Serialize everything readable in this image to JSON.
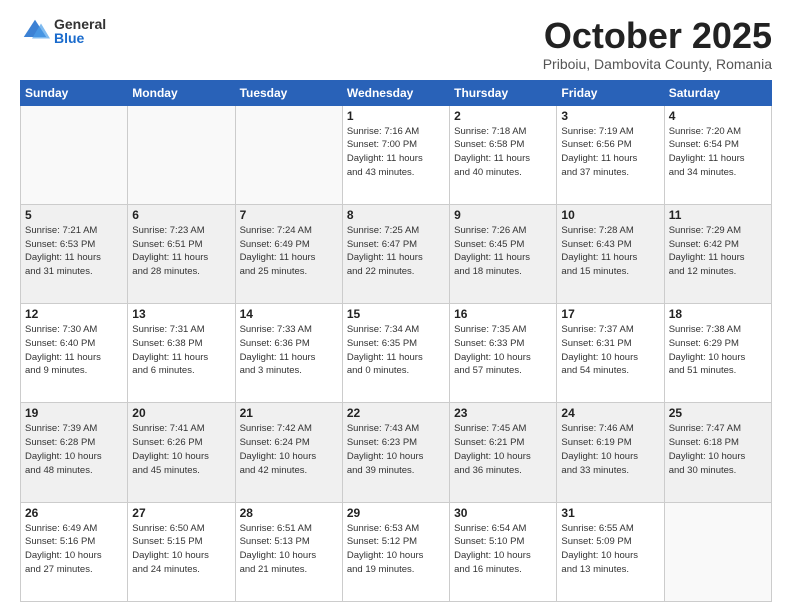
{
  "logo": {
    "general": "General",
    "blue": "Blue"
  },
  "header": {
    "month": "October 2025",
    "location": "Priboiu, Dambovita County, Romania"
  },
  "days_of_week": [
    "Sunday",
    "Monday",
    "Tuesday",
    "Wednesday",
    "Thursday",
    "Friday",
    "Saturday"
  ],
  "weeks": [
    [
      {
        "day": "",
        "info": ""
      },
      {
        "day": "",
        "info": ""
      },
      {
        "day": "",
        "info": ""
      },
      {
        "day": "1",
        "info": "Sunrise: 7:16 AM\nSunset: 7:00 PM\nDaylight: 11 hours\nand 43 minutes."
      },
      {
        "day": "2",
        "info": "Sunrise: 7:18 AM\nSunset: 6:58 PM\nDaylight: 11 hours\nand 40 minutes."
      },
      {
        "day": "3",
        "info": "Sunrise: 7:19 AM\nSunset: 6:56 PM\nDaylight: 11 hours\nand 37 minutes."
      },
      {
        "day": "4",
        "info": "Sunrise: 7:20 AM\nSunset: 6:54 PM\nDaylight: 11 hours\nand 34 minutes."
      }
    ],
    [
      {
        "day": "5",
        "info": "Sunrise: 7:21 AM\nSunset: 6:53 PM\nDaylight: 11 hours\nand 31 minutes."
      },
      {
        "day": "6",
        "info": "Sunrise: 7:23 AM\nSunset: 6:51 PM\nDaylight: 11 hours\nand 28 minutes."
      },
      {
        "day": "7",
        "info": "Sunrise: 7:24 AM\nSunset: 6:49 PM\nDaylight: 11 hours\nand 25 minutes."
      },
      {
        "day": "8",
        "info": "Sunrise: 7:25 AM\nSunset: 6:47 PM\nDaylight: 11 hours\nand 22 minutes."
      },
      {
        "day": "9",
        "info": "Sunrise: 7:26 AM\nSunset: 6:45 PM\nDaylight: 11 hours\nand 18 minutes."
      },
      {
        "day": "10",
        "info": "Sunrise: 7:28 AM\nSunset: 6:43 PM\nDaylight: 11 hours\nand 15 minutes."
      },
      {
        "day": "11",
        "info": "Sunrise: 7:29 AM\nSunset: 6:42 PM\nDaylight: 11 hours\nand 12 minutes."
      }
    ],
    [
      {
        "day": "12",
        "info": "Sunrise: 7:30 AM\nSunset: 6:40 PM\nDaylight: 11 hours\nand 9 minutes."
      },
      {
        "day": "13",
        "info": "Sunrise: 7:31 AM\nSunset: 6:38 PM\nDaylight: 11 hours\nand 6 minutes."
      },
      {
        "day": "14",
        "info": "Sunrise: 7:33 AM\nSunset: 6:36 PM\nDaylight: 11 hours\nand 3 minutes."
      },
      {
        "day": "15",
        "info": "Sunrise: 7:34 AM\nSunset: 6:35 PM\nDaylight: 11 hours\nand 0 minutes."
      },
      {
        "day": "16",
        "info": "Sunrise: 7:35 AM\nSunset: 6:33 PM\nDaylight: 10 hours\nand 57 minutes."
      },
      {
        "day": "17",
        "info": "Sunrise: 7:37 AM\nSunset: 6:31 PM\nDaylight: 10 hours\nand 54 minutes."
      },
      {
        "day": "18",
        "info": "Sunrise: 7:38 AM\nSunset: 6:29 PM\nDaylight: 10 hours\nand 51 minutes."
      }
    ],
    [
      {
        "day": "19",
        "info": "Sunrise: 7:39 AM\nSunset: 6:28 PM\nDaylight: 10 hours\nand 48 minutes."
      },
      {
        "day": "20",
        "info": "Sunrise: 7:41 AM\nSunset: 6:26 PM\nDaylight: 10 hours\nand 45 minutes."
      },
      {
        "day": "21",
        "info": "Sunrise: 7:42 AM\nSunset: 6:24 PM\nDaylight: 10 hours\nand 42 minutes."
      },
      {
        "day": "22",
        "info": "Sunrise: 7:43 AM\nSunset: 6:23 PM\nDaylight: 10 hours\nand 39 minutes."
      },
      {
        "day": "23",
        "info": "Sunrise: 7:45 AM\nSunset: 6:21 PM\nDaylight: 10 hours\nand 36 minutes."
      },
      {
        "day": "24",
        "info": "Sunrise: 7:46 AM\nSunset: 6:19 PM\nDaylight: 10 hours\nand 33 minutes."
      },
      {
        "day": "25",
        "info": "Sunrise: 7:47 AM\nSunset: 6:18 PM\nDaylight: 10 hours\nand 30 minutes."
      }
    ],
    [
      {
        "day": "26",
        "info": "Sunrise: 6:49 AM\nSunset: 5:16 PM\nDaylight: 10 hours\nand 27 minutes."
      },
      {
        "day": "27",
        "info": "Sunrise: 6:50 AM\nSunset: 5:15 PM\nDaylight: 10 hours\nand 24 minutes."
      },
      {
        "day": "28",
        "info": "Sunrise: 6:51 AM\nSunset: 5:13 PM\nDaylight: 10 hours\nand 21 minutes."
      },
      {
        "day": "29",
        "info": "Sunrise: 6:53 AM\nSunset: 5:12 PM\nDaylight: 10 hours\nand 19 minutes."
      },
      {
        "day": "30",
        "info": "Sunrise: 6:54 AM\nSunset: 5:10 PM\nDaylight: 10 hours\nand 16 minutes."
      },
      {
        "day": "31",
        "info": "Sunrise: 6:55 AM\nSunset: 5:09 PM\nDaylight: 10 hours\nand 13 minutes."
      },
      {
        "day": "",
        "info": ""
      }
    ]
  ]
}
